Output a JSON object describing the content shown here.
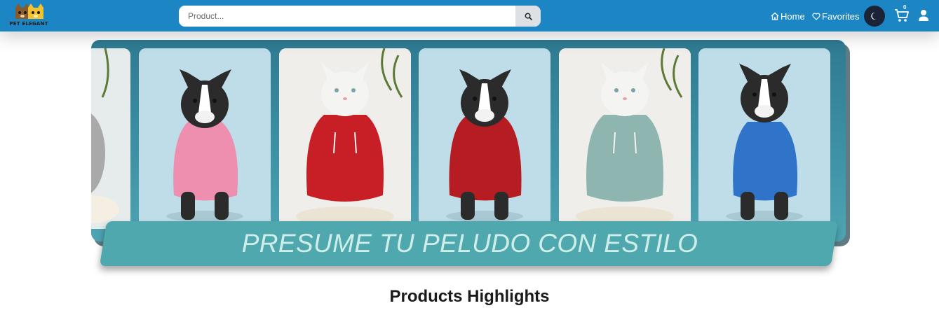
{
  "navbar": {
    "logo_text": "PET ELEGANT",
    "search_placeholder": "Product...",
    "search_icon": "search-icon",
    "home_label": "Home",
    "home_icon": "home-icon",
    "favorites_label": "Favorites",
    "favorites_icon": "heart-icon",
    "theme_icon": "moon-icon",
    "cart_icon": "cart-icon",
    "cart_count": "0",
    "user_icon": "user-icon",
    "colors": {
      "bar": "#1c86c4",
      "theme_button": "#1b2336"
    }
  },
  "banner": {
    "slogan": "PRESUME TU PELUDO CON ESTILO",
    "panels": [
      {
        "animal": "dog",
        "hoodie_color": "#a8a8a8"
      },
      {
        "animal": "dog",
        "hoodie_color": "#ef8fb0"
      },
      {
        "animal": "cat",
        "hoodie_color": "#c81f26"
      },
      {
        "animal": "dog",
        "hoodie_color": "#b51d22"
      },
      {
        "animal": "cat",
        "hoodie_color": "#8fb5b0"
      },
      {
        "animal": "dog",
        "hoodie_color": "#2f74c8"
      }
    ],
    "colors": {
      "background": "#3f93a6",
      "strip": "#4fa8ad",
      "slogan": "#cfeee9"
    }
  },
  "section": {
    "title": "Products Highlights"
  }
}
